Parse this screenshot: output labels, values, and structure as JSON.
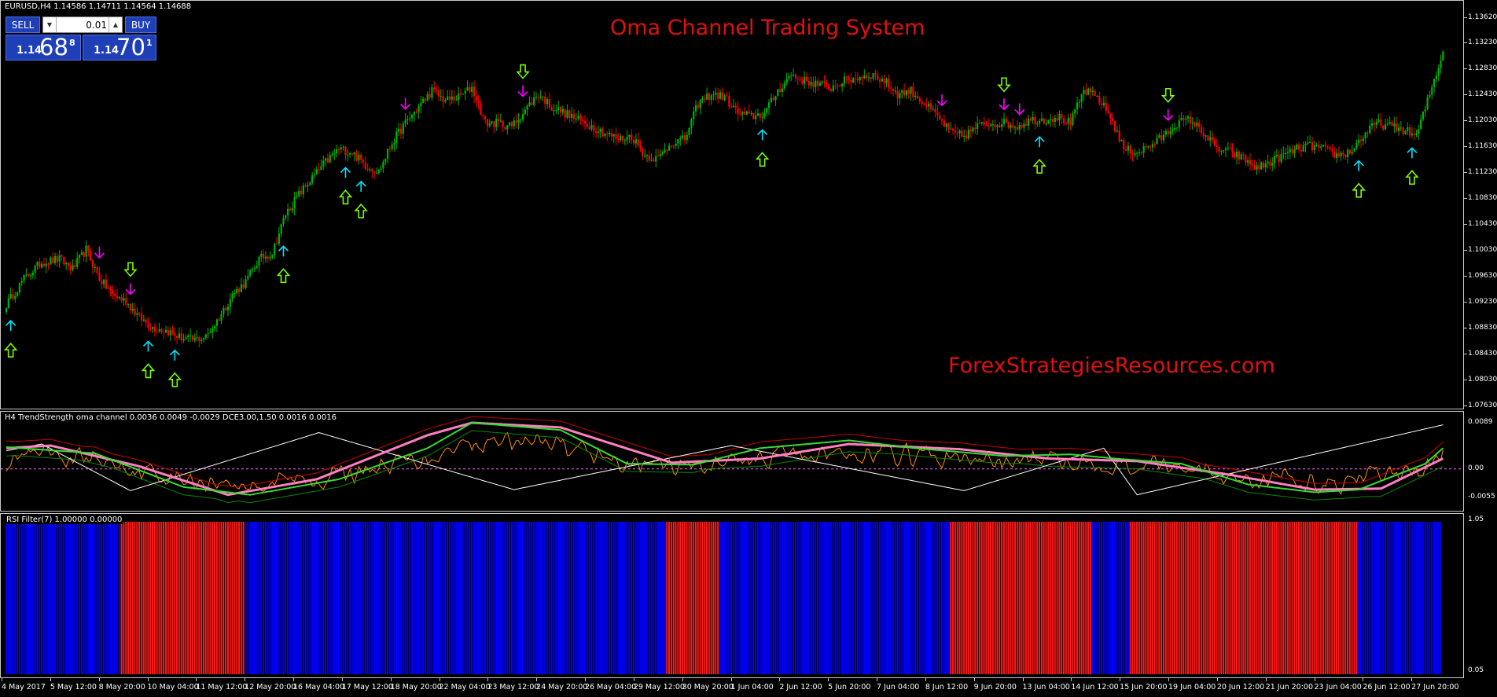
{
  "symbol_title": "EURUSD,H4  1.14586 1.14711 1.14564 1.14688",
  "chart_overlay_title": "Oma Channel Trading System",
  "watermark": "ForexStrategiesResources.com",
  "trade_panel": {
    "sell_label": "SELL",
    "buy_label": "BUY",
    "lot_value": "0.01",
    "lot_down_icon": "triangle-down-icon",
    "lot_up_icon": "triangle-up-icon",
    "sell_prefix": "1.14",
    "sell_big": "68",
    "sell_sup": "8",
    "buy_prefix": "1.14",
    "buy_big": "70",
    "buy_sup": "1"
  },
  "price_scale": [
    "1.13620",
    "1.13230",
    "1.12830",
    "1.12430",
    "1.12030",
    "1.11630",
    "1.11230",
    "1.10830",
    "1.10430",
    "1.10030",
    "1.09630",
    "1.09230",
    "1.08830",
    "1.08430",
    "1.08030",
    "1.07630"
  ],
  "indicator1": {
    "title": "H4 TrendStrength oma channel 0.0036 0.0049 -0.0029  DCE3.00,1.50 0.0016 0.0016",
    "scale": [
      "0.0089",
      "0.00",
      "-0.0055"
    ]
  },
  "indicator2": {
    "title": "RSI Filter(7) 1.00000 0.00000",
    "scale": [
      "1.05",
      "0.05"
    ]
  },
  "time_axis": [
    "4 May 2017",
    "5 May 12:00",
    "8 May 20:00",
    "10 May 04:00",
    "11 May 12:00",
    "12 May 20:00",
    "16 May 04:00",
    "17 May 12:00",
    "18 May 20:00",
    "22 May 04:00",
    "23 May 12:00",
    "24 May 20:00",
    "26 May 04:00",
    "29 May 12:00",
    "30 May 20:00",
    "1 Jun 04:00",
    "2 Jun 12:00",
    "5 Jun 20:00",
    "7 Jun 04:00",
    "8 Jun 12:00",
    "9 Jun 20:00",
    "13 Jun 04:00",
    "14 Jun 12:00",
    "15 Jun 20:00",
    "19 Jun 04:00",
    "20 Jun 12:00",
    "21 Jun 20:00",
    "23 Jun 04:00",
    "26 Jun 12:00",
    "27 Jun 20:00"
  ],
  "colors": {
    "bull_candle": "#00b400",
    "bear_candle": "#ff0000",
    "cyan_arrow": "#00e5ff",
    "magenta_arrow": "#ff00ff",
    "signal_arrow": "#7cfc00",
    "rsi_blue": "#0000ff",
    "rsi_red": "#ff1a1a"
  },
  "chart_data": {
    "type": "candlestick",
    "symbol": "EURUSD",
    "timeframe": "H4",
    "ylim": [
      1.0763,
      1.1375
    ],
    "close_path": [
      [
        0,
        1.092
      ],
      [
        8,
        1.096
      ],
      [
        16,
        1.0985
      ],
      [
        24,
        1.099
      ],
      [
        30,
        1.0975
      ],
      [
        36,
        1.1005
      ],
      [
        42,
        1.096
      ],
      [
        48,
        1.0935
      ],
      [
        54,
        1.0925
      ],
      [
        60,
        1.09
      ],
      [
        66,
        1.0885
      ],
      [
        72,
        1.088
      ],
      [
        78,
        1.087
      ],
      [
        84,
        1.0865
      ],
      [
        90,
        1.087
      ],
      [
        96,
        1.09
      ],
      [
        102,
        1.0935
      ],
      [
        108,
        1.0955
      ],
      [
        114,
        1.099
      ],
      [
        120,
        1.1
      ],
      [
        126,
        1.106
      ],
      [
        132,
        1.109
      ],
      [
        138,
        1.1115
      ],
      [
        144,
        1.114
      ],
      [
        150,
        1.116
      ],
      [
        156,
        1.1155
      ],
      [
        162,
        1.1135
      ],
      [
        168,
        1.1125
      ],
      [
        174,
        1.117
      ],
      [
        180,
        1.12
      ],
      [
        186,
        1.1225
      ],
      [
        192,
        1.125
      ],
      [
        198,
        1.1235
      ],
      [
        204,
        1.124
      ],
      [
        210,
        1.1255
      ],
      [
        216,
        1.12
      ],
      [
        222,
        1.12
      ],
      [
        228,
        1.1195
      ],
      [
        234,
        1.122
      ],
      [
        240,
        1.1245
      ],
      [
        246,
        1.1225
      ],
      [
        252,
        1.1215
      ],
      [
        258,
        1.1205
      ],
      [
        264,
        1.1195
      ],
      [
        270,
        1.1185
      ],
      [
        276,
        1.1175
      ],
      [
        282,
        1.118
      ],
      [
        288,
        1.115
      ],
      [
        294,
        1.1145
      ],
      [
        300,
        1.117
      ],
      [
        306,
        1.1175
      ],
      [
        312,
        1.123
      ],
      [
        318,
        1.1245
      ],
      [
        324,
        1.124
      ],
      [
        330,
        1.1215
      ],
      [
        336,
        1.121
      ],
      [
        342,
        1.1215
      ],
      [
        348,
        1.125
      ],
      [
        354,
        1.1275
      ],
      [
        360,
        1.1265
      ],
      [
        366,
        1.126
      ],
      [
        372,
        1.1255
      ],
      [
        378,
        1.1265
      ],
      [
        384,
        1.127
      ],
      [
        390,
        1.1275
      ],
      [
        396,
        1.1265
      ],
      [
        402,
        1.1245
      ],
      [
        408,
        1.125
      ],
      [
        414,
        1.123
      ],
      [
        420,
        1.121
      ],
      [
        426,
        1.1185
      ],
      [
        432,
        1.118
      ],
      [
        438,
        1.1195
      ],
      [
        444,
        1.12
      ],
      [
        450,
        1.12
      ],
      [
        456,
        1.1195
      ],
      [
        462,
        1.1205
      ],
      [
        468,
        1.1205
      ],
      [
        474,
        1.121
      ],
      [
        480,
        1.12
      ],
      [
        486,
        1.125
      ],
      [
        492,
        1.124
      ],
      [
        498,
        1.121
      ],
      [
        504,
        1.116
      ],
      [
        510,
        1.1155
      ],
      [
        516,
        1.1165
      ],
      [
        522,
        1.118
      ],
      [
        528,
        1.12
      ],
      [
        534,
        1.1205
      ],
      [
        540,
        1.1185
      ],
      [
        546,
        1.116
      ],
      [
        552,
        1.1155
      ],
      [
        558,
        1.1145
      ],
      [
        564,
        1.113
      ],
      [
        570,
        1.114
      ],
      [
        576,
        1.115
      ],
      [
        582,
        1.116
      ],
      [
        588,
        1.1165
      ],
      [
        594,
        1.116
      ],
      [
        600,
        1.115
      ],
      [
        606,
        1.1155
      ],
      [
        612,
        1.118
      ],
      [
        618,
        1.12
      ],
      [
        624,
        1.1195
      ],
      [
        630,
        1.119
      ],
      [
        636,
        1.118
      ],
      [
        642,
        1.1245
      ],
      [
        648,
        1.131
      ]
    ],
    "buy_signals_bar": [
      2,
      64,
      76,
      125,
      153,
      160,
      341,
      466,
      610,
      634
    ],
    "sell_signals_bar": [
      42,
      56,
      180,
      233,
      422,
      450,
      457,
      524
    ],
    "rsi_filter": {
      "ylim": [
        0.05,
        1.05
      ],
      "segments": [
        {
          "from": 0,
          "to": 52,
          "value": 0
        },
        {
          "from": 52,
          "to": 108,
          "value": 1
        },
        {
          "from": 108,
          "to": 298,
          "value": 0
        },
        {
          "from": 298,
          "to": 322,
          "value": 1
        },
        {
          "from": 322,
          "to": 426,
          "value": 0
        },
        {
          "from": 426,
          "to": 490,
          "value": 1
        },
        {
          "from": 490,
          "to": 507,
          "value": 0
        },
        {
          "from": 507,
          "to": 610,
          "value": 1
        },
        {
          "from": 610,
          "to": 648,
          "value": 0
        }
      ]
    },
    "trend_strength": {
      "ylim": [
        -0.0055,
        0.0089
      ],
      "green_path": [
        [
          0,
          0.0042
        ],
        [
          40,
          0.003
        ],
        [
          80,
          -0.0035
        ],
        [
          110,
          -0.005
        ],
        [
          150,
          -0.002
        ],
        [
          190,
          0.004
        ],
        [
          210,
          0.0089
        ],
        [
          250,
          0.0075
        ],
        [
          280,
          0.001
        ],
        [
          310,
          0.0008
        ],
        [
          340,
          0.004
        ],
        [
          380,
          0.0055
        ],
        [
          410,
          0.004
        ],
        [
          450,
          0.0025
        ],
        [
          480,
          0.0028
        ],
        [
          500,
          0.002
        ],
        [
          530,
          0.001
        ],
        [
          560,
          -0.003
        ],
        [
          590,
          -0.0045
        ],
        [
          610,
          -0.004
        ],
        [
          640,
          0.001
        ],
        [
          648,
          0.004
        ]
      ],
      "pink_path": [
        [
          0,
          0.004
        ],
        [
          20,
          0.0045
        ],
        [
          60,
          0.0005
        ],
        [
          100,
          -0.005
        ],
        [
          140,
          -0.002
        ],
        [
          190,
          0.0065
        ],
        [
          210,
          0.0089
        ],
        [
          250,
          0.008
        ],
        [
          300,
          0.0012
        ],
        [
          340,
          0.002
        ],
        [
          380,
          0.0048
        ],
        [
          430,
          0.0038
        ],
        [
          470,
          0.002
        ],
        [
          510,
          0.0015
        ],
        [
          550,
          -0.001
        ],
        [
          590,
          -0.004
        ],
        [
          620,
          -0.0038
        ],
        [
          648,
          0.002
        ]
      ],
      "zigzag": [
        [
          0,
          0.0035
        ],
        [
          16,
          0.0048
        ],
        [
          56,
          -0.0042
        ],
        [
          141,
          0.007
        ],
        [
          229,
          -0.004
        ],
        [
          327,
          0.0045
        ],
        [
          432,
          -0.0042
        ],
        [
          495,
          0.004
        ],
        [
          510,
          -0.005
        ],
        [
          648,
          0.0085
        ]
      ]
    }
  }
}
